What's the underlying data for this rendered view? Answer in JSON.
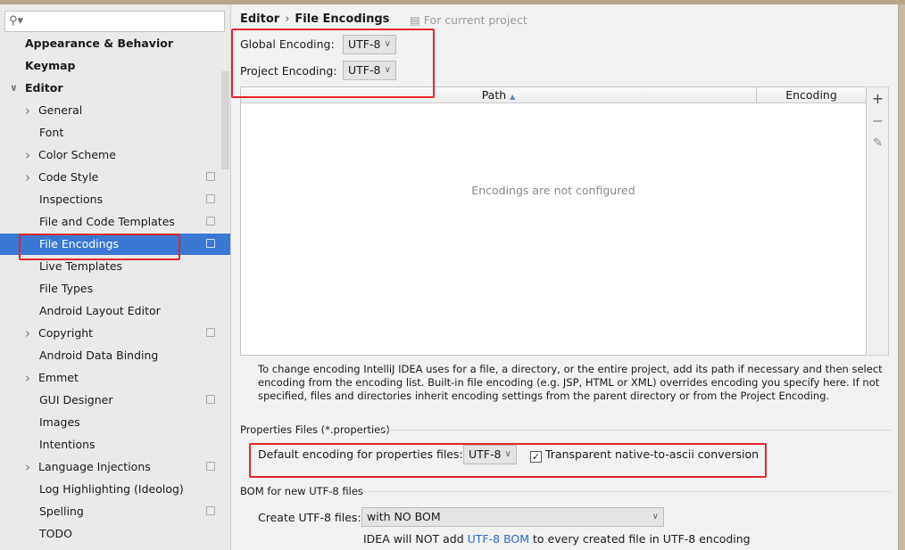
{
  "search": {
    "placeholder": ""
  },
  "sidebar": {
    "items": [
      {
        "label": "Appearance & Behavior",
        "level": 0,
        "bold": true
      },
      {
        "label": "Keymap",
        "level": 0,
        "bold": true
      },
      {
        "label": "Editor",
        "level": 0,
        "bold": true,
        "expanded": true
      },
      {
        "label": "General",
        "level": 1,
        "expandable": true
      },
      {
        "label": "Font",
        "level": 1
      },
      {
        "label": "Color Scheme",
        "level": 1,
        "expandable": true
      },
      {
        "label": "Code Style",
        "level": 1,
        "expandable": true,
        "project": true
      },
      {
        "label": "Inspections",
        "level": 1,
        "project": true
      },
      {
        "label": "File and Code Templates",
        "level": 1,
        "project": true
      },
      {
        "label": "File Encodings",
        "level": 1,
        "project": true,
        "selected": true
      },
      {
        "label": "Live Templates",
        "level": 1
      },
      {
        "label": "File Types",
        "level": 1
      },
      {
        "label": "Android Layout Editor",
        "level": 1
      },
      {
        "label": "Copyright",
        "level": 1,
        "expandable": true,
        "project": true
      },
      {
        "label": "Android Data Binding",
        "level": 1
      },
      {
        "label": "Emmet",
        "level": 1,
        "expandable": true
      },
      {
        "label": "GUI Designer",
        "level": 1,
        "project": true
      },
      {
        "label": "Images",
        "level": 1
      },
      {
        "label": "Intentions",
        "level": 1
      },
      {
        "label": "Language Injections",
        "level": 1,
        "expandable": true,
        "project": true
      },
      {
        "label": "Log Highlighting (Ideolog)",
        "level": 1
      },
      {
        "label": "Spelling",
        "level": 1,
        "project": true
      },
      {
        "label": "TODO",
        "level": 1
      }
    ]
  },
  "breadcrumb": {
    "parent": "Editor",
    "current": "File Encodings",
    "scope": "For current project"
  },
  "global_encoding": {
    "label": "Global Encoding:",
    "value": "UTF-8"
  },
  "project_encoding": {
    "label": "Project Encoding:",
    "value": "UTF-8"
  },
  "table": {
    "columns": [
      "Path",
      "Encoding"
    ],
    "sort_indicator": "▲",
    "empty_text": "Encodings are not configured",
    "tools": [
      "+",
      "−",
      "✎"
    ]
  },
  "description": "To change encoding IntelliJ IDEA uses for a file, a directory, or the entire project, add its path if necessary and then select encoding from the encoding list. Built-in file encoding (e.g. JSP, HTML or XML) overrides encoding you specify here. If not specified, files and directories inherit encoding settings from the parent directory or from the Project Encoding.",
  "properties": {
    "section": "Properties Files (*.properties)",
    "default_label": "Default encoding for properties files:",
    "default_value": "UTF-8",
    "transparent_label": "Transparent native-to-ascii conversion",
    "transparent_checked": true
  },
  "bom": {
    "section": "BOM for new UTF-8 files",
    "create_label": "Create UTF-8 files:",
    "create_value": "with NO BOM",
    "note_prefix": "IDEA will NOT add ",
    "note_link": "UTF-8 BOM",
    "note_suffix": " to every created file in UTF-8 encoding"
  },
  "colors": {
    "selection": "#3a78d3",
    "annotation": "#e3262b",
    "link": "#2b6dbf"
  }
}
